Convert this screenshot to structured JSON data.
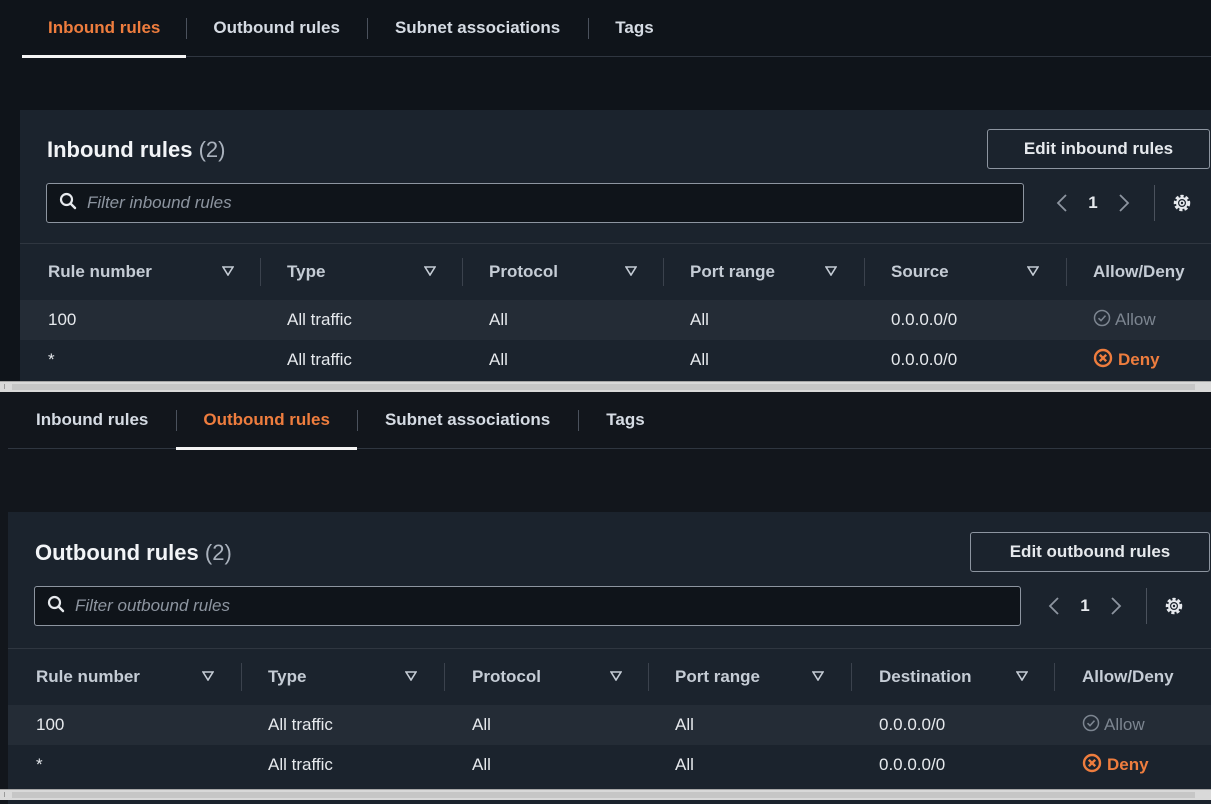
{
  "colors": {
    "accent": "#ee7d3e",
    "deny": "#ee7d3e",
    "allow": "#7c8590"
  },
  "inbound_view": {
    "tabs": [
      "Inbound rules",
      "Outbound rules",
      "Subnet associations",
      "Tags"
    ],
    "active_tab": 0,
    "title": "Inbound rules",
    "count": "(2)",
    "edit_button": "Edit inbound rules",
    "filter_placeholder": "Filter inbound rules",
    "page": "1",
    "columns": [
      "Rule number",
      "Type",
      "Protocol",
      "Port range",
      "Source",
      "Allow/Deny"
    ],
    "rows": [
      {
        "rule": "100",
        "type": "All traffic",
        "protocol": "All",
        "port": "All",
        "target": "0.0.0.0/0",
        "action": "Allow"
      },
      {
        "rule": "*",
        "type": "All traffic",
        "protocol": "All",
        "port": "All",
        "target": "0.0.0.0/0",
        "action": "Deny"
      }
    ]
  },
  "outbound_view": {
    "tabs": [
      "Inbound rules",
      "Outbound rules",
      "Subnet associations",
      "Tags"
    ],
    "active_tab": 1,
    "title": "Outbound rules",
    "count": "(2)",
    "edit_button": "Edit outbound rules",
    "filter_placeholder": "Filter outbound rules",
    "page": "1",
    "columns": [
      "Rule number",
      "Type",
      "Protocol",
      "Port range",
      "Destination",
      "Allow/Deny"
    ],
    "rows": [
      {
        "rule": "100",
        "type": "All traffic",
        "protocol": "All",
        "port": "All",
        "target": "0.0.0.0/0",
        "action": "Allow"
      },
      {
        "rule": "*",
        "type": "All traffic",
        "protocol": "All",
        "port": "All",
        "target": "0.0.0.0/0",
        "action": "Deny"
      }
    ]
  },
  "icons": {
    "filter": "search-icon",
    "prev": "chevron-left-icon",
    "next": "chevron-right-icon",
    "settings": "gear-icon",
    "sort": "sort-down-icon",
    "allow": "check-circle-icon",
    "deny": "x-circle-icon"
  }
}
